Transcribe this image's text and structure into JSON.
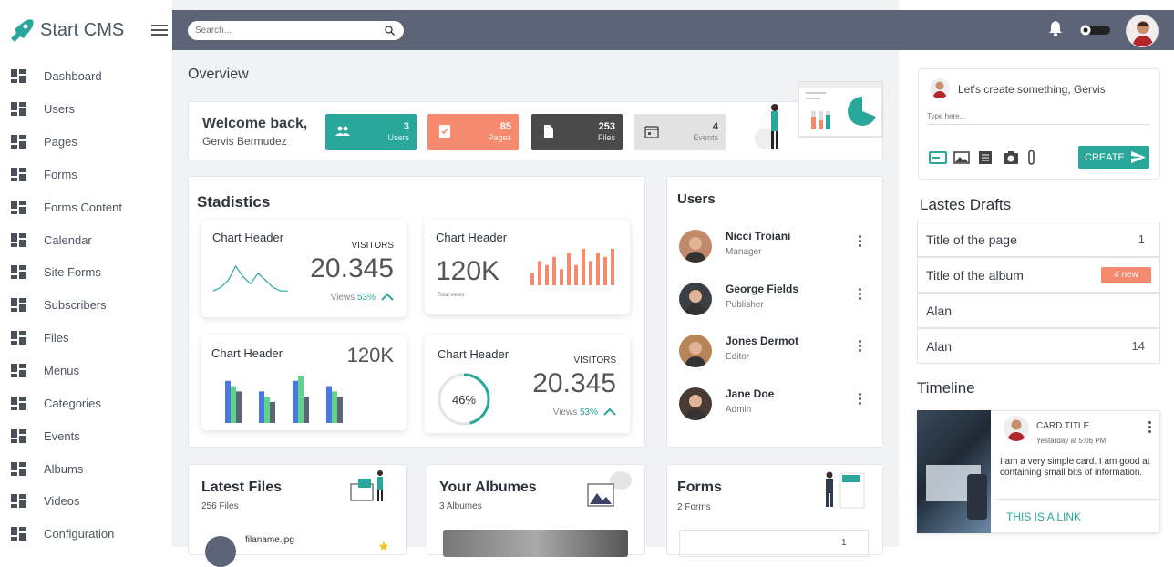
{
  "app": {
    "name": "Start CMS"
  },
  "sidebar": {
    "items": [
      {
        "label": "Dashboard"
      },
      {
        "label": "Users"
      },
      {
        "label": "Pages"
      },
      {
        "label": "Forms"
      },
      {
        "label": "Forms Content"
      },
      {
        "label": "Calendar"
      },
      {
        "label": "Site Forms"
      },
      {
        "label": "Subscribers"
      },
      {
        "label": "Files"
      },
      {
        "label": "Menus"
      },
      {
        "label": "Categories"
      },
      {
        "label": "Events"
      },
      {
        "label": "Albums"
      },
      {
        "label": "Videos"
      },
      {
        "label": "Configuration"
      }
    ]
  },
  "topbar": {
    "search_placeholder": "Search..."
  },
  "overview": {
    "title": "Overview",
    "welcome": "Welcome back,",
    "user_name": "Gervis Bermudez",
    "stats": [
      {
        "value": "3",
        "label": "Users",
        "color": "#2aa79b"
      },
      {
        "value": "85",
        "label": "Pages",
        "color": "#f58a6e"
      },
      {
        "value": "253",
        "label": "Files",
        "color": "#4a4a4a"
      },
      {
        "value": "4",
        "label": "Events",
        "color": "#e2e2e2"
      }
    ]
  },
  "statistics": {
    "title": "Stadistics",
    "card1": {
      "header": "Chart Header",
      "caption": "VISITORS",
      "value": "20.345",
      "views_label": "Views",
      "views_pct": "53%"
    },
    "card2": {
      "header": "Chart Header",
      "value": "120K",
      "sub": "Total views"
    },
    "card3": {
      "header": "Chart Header",
      "value": "120K"
    },
    "card4": {
      "header": "Chart Header",
      "caption": "VISITORS",
      "value": "20.345",
      "ring": "46%",
      "ring_fraction": 0.46,
      "views_label": "Views",
      "views_pct": "53%"
    }
  },
  "users": {
    "title": "Users",
    "list": [
      {
        "name": "Nicci Troiani",
        "role": "Manager"
      },
      {
        "name": "George Fields",
        "role": "Publisher"
      },
      {
        "name": "Jones Dermot",
        "role": "Editor"
      },
      {
        "name": "Jane Doe",
        "role": "Admin"
      }
    ]
  },
  "files": {
    "title": "Latest Files",
    "count": "256 Files",
    "first": "filaname.jpg"
  },
  "albums": {
    "title": "Your Albumes",
    "count": "3 Albumes"
  },
  "forms": {
    "title": "Forms",
    "count": "2 Forms",
    "first_num": "1"
  },
  "create": {
    "prompt": "Let's create something, Gervis",
    "placeholder": "Type here...",
    "button": "CREATE"
  },
  "drafts": {
    "title": "Lastes Drafts",
    "items": [
      {
        "title": "Title of the page",
        "value": "1"
      },
      {
        "title": "Title of the album",
        "badge": "4 new"
      },
      {
        "title": "Alan",
        "value": ""
      },
      {
        "title": "Alan",
        "value": "14"
      }
    ]
  },
  "timeline": {
    "title": "Timeline",
    "card_title": "CARD TITLE",
    "time": "Yestarday at 5:06 PM",
    "text": "I am a very simple card. I am good at containing small bits of information.",
    "link": "THIS IS A LINK"
  },
  "chart_data": [
    {
      "type": "line",
      "title": "Chart Header",
      "values": [
        2,
        3,
        5,
        9,
        6,
        4,
        7,
        5,
        3,
        2,
        2
      ]
    },
    {
      "type": "bar",
      "title": "Chart Header",
      "values": [
        3,
        6,
        5,
        7,
        4,
        8,
        5,
        9,
        6,
        8,
        7,
        9
      ]
    },
    {
      "type": "bar",
      "title": "Chart Header",
      "series": [
        {
          "values": [
            8,
            6,
            8,
            7
          ]
        },
        {
          "values": [
            7,
            5,
            9,
            6
          ]
        },
        {
          "values": [
            6,
            4,
            5,
            5
          ]
        }
      ]
    }
  ]
}
